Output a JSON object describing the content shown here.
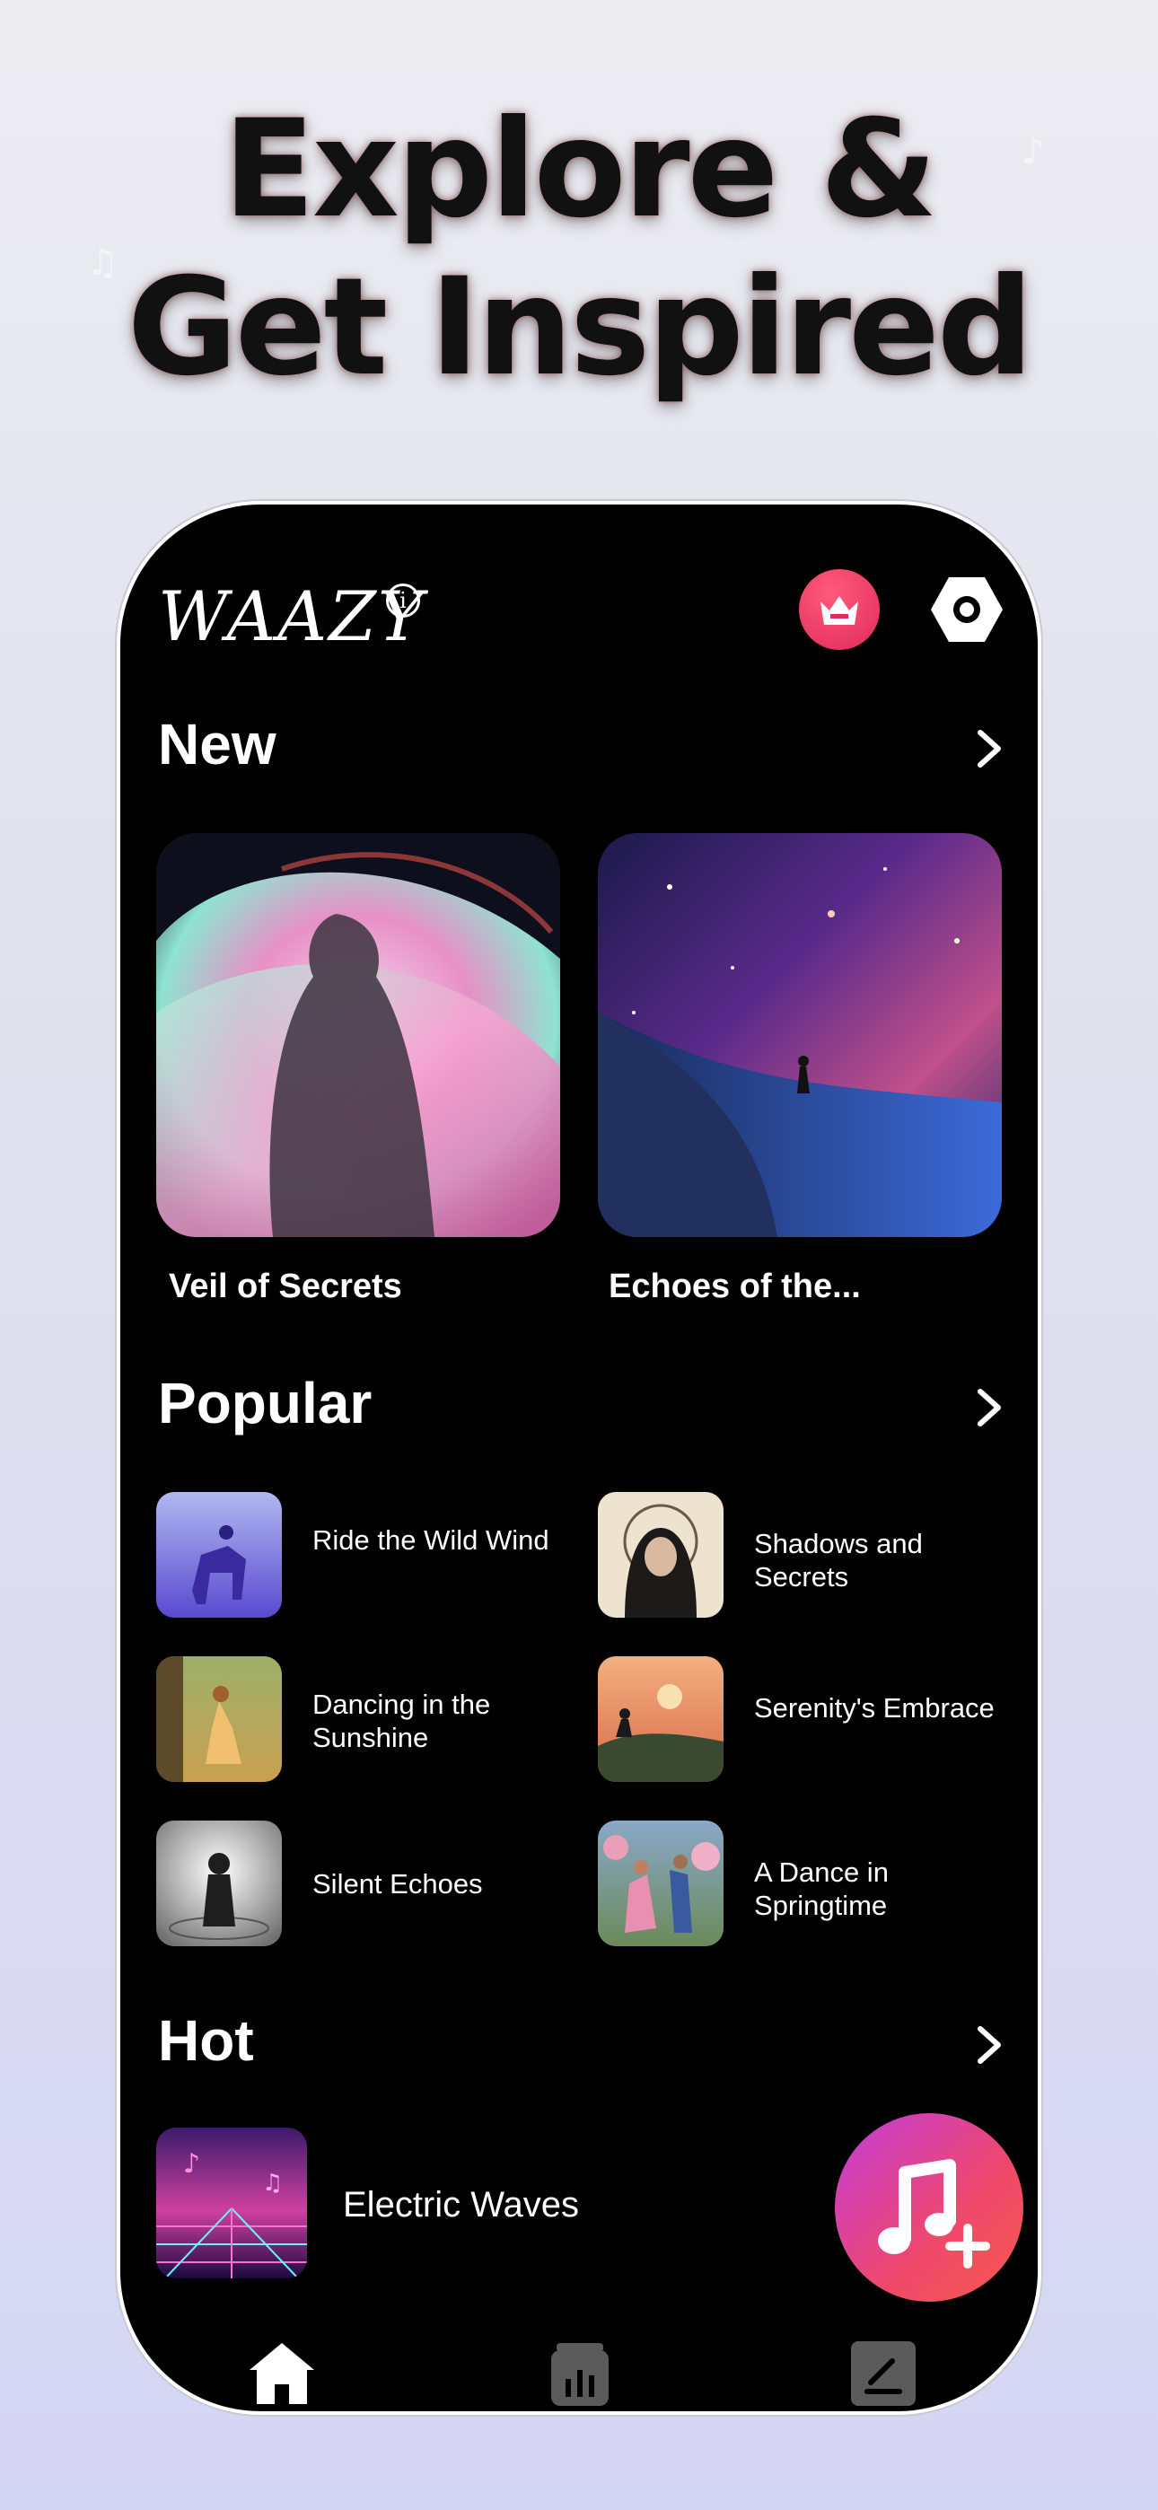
{
  "headline": {
    "line1": "Explore &",
    "line2": "Get Inspired"
  },
  "app": {
    "logo_text": "WAAZY",
    "info_icon": "info-icon",
    "premium_icon": "crown-icon",
    "settings_icon": "settings-icon"
  },
  "sections": {
    "new": {
      "title": "New",
      "items": [
        {
          "title": "Veil of Secrets"
        },
        {
          "title": "Echoes of the..."
        }
      ]
    },
    "popular": {
      "title": "Popular",
      "items": [
        {
          "title": "Ride the Wild Wind"
        },
        {
          "title": "Shadows and Secrets"
        },
        {
          "title": "Dancing in the Sunshine"
        },
        {
          "title": "Serenity's Embrace"
        },
        {
          "title": "Silent Echoes"
        },
        {
          "title": "A Dance in Springtime"
        }
      ]
    },
    "hot": {
      "title": "Hot",
      "items": [
        {
          "title": "Electric Waves"
        }
      ]
    }
  },
  "fab_icon": "music-add-icon",
  "tabs": [
    {
      "icon": "home-icon",
      "active": true
    },
    {
      "icon": "chart-icon",
      "active": false
    },
    {
      "icon": "edit-icon",
      "active": false
    }
  ],
  "colors": {
    "accent": "#e02a5c",
    "fab_start": "#c13dd8",
    "fab_end": "#f45a4a",
    "background": "#000000"
  }
}
